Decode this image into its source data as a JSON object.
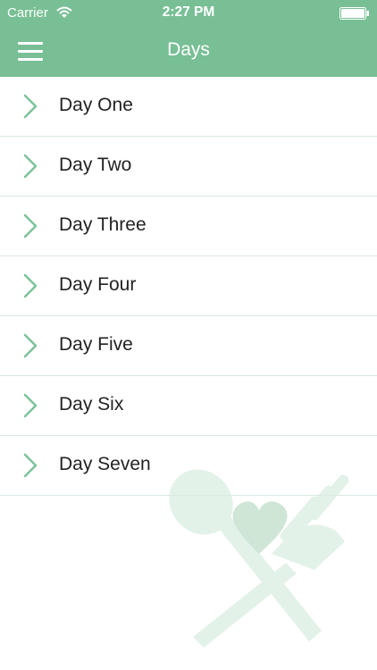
{
  "status_bar": {
    "carrier": "Carrier",
    "time": "2:27 PM",
    "wifi_icon": "wifi-icon",
    "battery_icon": "battery-icon"
  },
  "nav": {
    "title": "Days",
    "menu_icon": "hamburger-menu-icon"
  },
  "days": [
    {
      "label": "Day One"
    },
    {
      "label": "Day Two"
    },
    {
      "label": "Day Three"
    },
    {
      "label": "Day Four"
    },
    {
      "label": "Day Five"
    },
    {
      "label": "Day Six"
    },
    {
      "label": "Day Seven"
    }
  ],
  "colors": {
    "accent": "#78bf95",
    "chevron": "#7cc29a",
    "watermark": "#e3f2e9",
    "watermark_heart": "#cfe6d7"
  }
}
